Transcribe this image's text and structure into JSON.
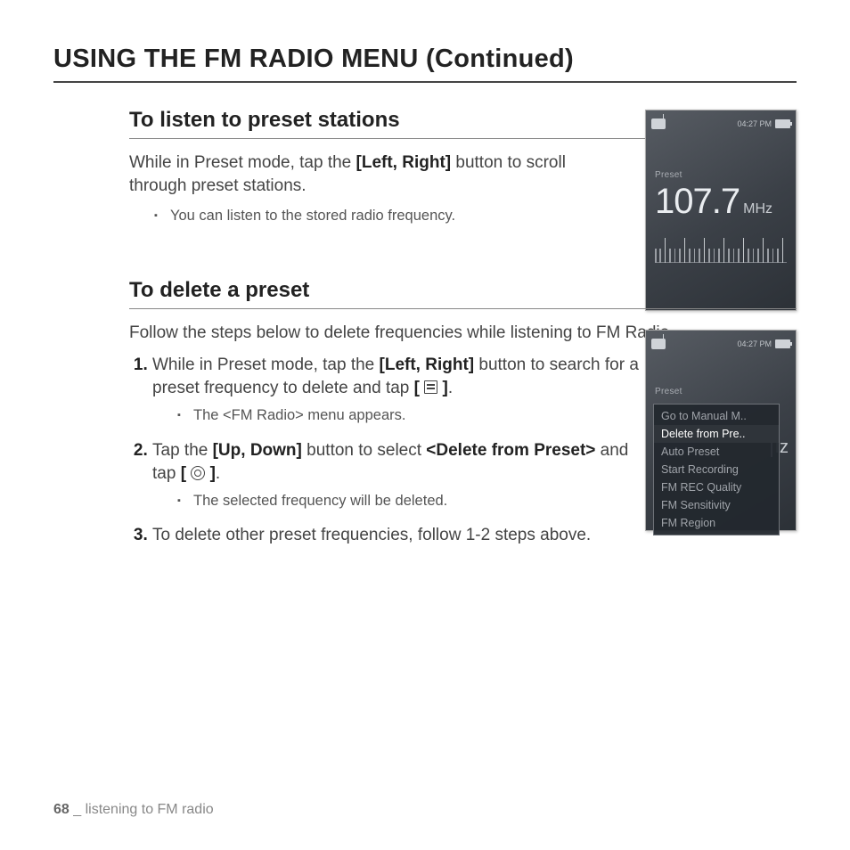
{
  "page_title": "USING THE FM RADIO MENU (Continued)",
  "section1": {
    "heading": "To listen to preset stations",
    "intro_pre": "While in Preset mode, tap the ",
    "intro_bold": "[Left, Right]",
    "intro_post": " button to scroll through preset stations.",
    "bullet1": "You can listen to the stored radio frequency."
  },
  "device1": {
    "time": "04:27 PM",
    "mode_label": "Preset",
    "frequency": "107.7",
    "unit": "MHz"
  },
  "section2": {
    "heading": "To delete a preset",
    "intro": "Follow the steps below to delete frequencies while listening to FM Radio.",
    "step1_pre": "While in Preset mode, tap the ",
    "step1_bold": "[Left, Right]",
    "step1_mid": " button to search for a preset frequency to delete and tap ",
    "step1_br_open": "[ ",
    "step1_br_close": " ]",
    "step1_end": ".",
    "step1_sub": "The <FM Radio> menu appears.",
    "step2_pre": "Tap the ",
    "step2_bold1": "[Up, Down]",
    "step2_mid": " button to select ",
    "step2_bold2": "<Delete from Preset>",
    "step2_mid2": " and tap ",
    "step2_br_open": "[ ",
    "step2_br_close": " ]",
    "step2_end": ".",
    "step2_sub": "The selected frequency will be deleted.",
    "step3": "To delete other preset frequencies, follow 1-2 steps above."
  },
  "device2": {
    "time": "04:27 PM",
    "mode_label": "Preset",
    "unit_fragment": "Iz",
    "menu": {
      "items": [
        "Go to Manual M..",
        "Delete from Pre..",
        "Auto Preset",
        "Start Recording",
        "FM REC Quality",
        "FM Sensitivity",
        "FM Region"
      ],
      "selected_index": 1
    }
  },
  "footer": {
    "page_number": "68",
    "separator": " _ ",
    "chapter": "listening to FM radio"
  }
}
